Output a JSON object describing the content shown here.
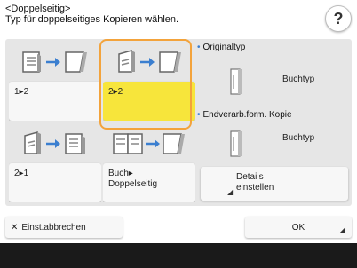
{
  "header": {
    "line1": "<Doppelseitig>",
    "line2": "Typ für doppelseitiges Kopieren wählen.",
    "help_symbol": "?"
  },
  "options": [
    {
      "label": "1▸2",
      "selected": false,
      "icons": [
        "single-sided-doc-icon",
        "arrow-right-icon",
        "double-sided-doc-icon"
      ]
    },
    {
      "label": "2▸2",
      "selected": true,
      "icons": [
        "double-sided-doc-icon",
        "arrow-right-icon",
        "double-sided-doc-icon"
      ]
    },
    {
      "label": "2▸1",
      "selected": false,
      "icons": [
        "double-sided-doc-icon",
        "arrow-right-icon",
        "single-sided-doc-icon"
      ]
    },
    {
      "label_line1": "Buch▸",
      "label_line2": "Doppelseitig",
      "selected": false,
      "icons": [
        "open-book-icon",
        "arrow-right-icon",
        "double-sided-doc-icon"
      ]
    }
  ],
  "original": {
    "heading": "Originaltyp",
    "value": "Buchtyp"
  },
  "finishing": {
    "heading": "Endverarb.form. Kopie",
    "value": "Buchtyp"
  },
  "details": {
    "line1": "Details",
    "line2": "einstellen"
  },
  "footer": {
    "cancel_label": "Einst.abbrechen",
    "ok_label": "OK"
  },
  "colors": {
    "selected_fill": "#f7e53b",
    "selected_border": "#f3a33b",
    "accent_dot": "#3b7fd0"
  }
}
